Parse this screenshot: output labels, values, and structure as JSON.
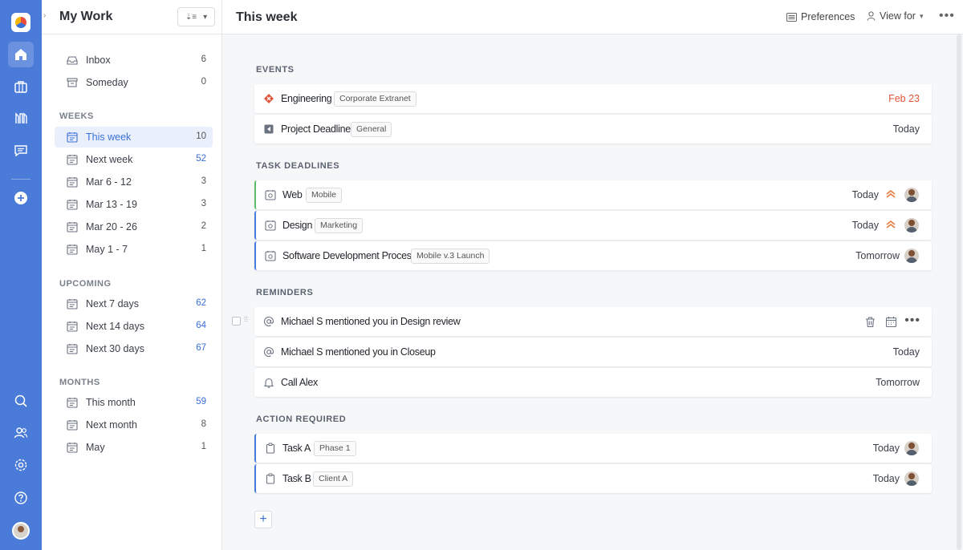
{
  "sidebar": {
    "title": "My Work",
    "top_items": [
      {
        "label": "Inbox",
        "count": "6"
      },
      {
        "label": "Someday",
        "count": "0"
      }
    ],
    "weeks_header": "WEEKS",
    "weeks": [
      {
        "label": "This week",
        "count": "10"
      },
      {
        "label": "Next week",
        "count": "52"
      },
      {
        "label": "Mar 6 - 12",
        "count": "3"
      },
      {
        "label": "Mar 13 - 19",
        "count": "3"
      },
      {
        "label": "Mar 20 - 26",
        "count": "2"
      },
      {
        "label": "May 1 - 7",
        "count": "1"
      }
    ],
    "upcoming_header": "UPCOMING",
    "upcoming": [
      {
        "label": "Next 7 days",
        "count": "62"
      },
      {
        "label": "Next 14 days",
        "count": "64"
      },
      {
        "label": "Next 30 days",
        "count": "67"
      }
    ],
    "months_header": "MONTHS",
    "months": [
      {
        "label": "This month",
        "count": "59"
      },
      {
        "label": "Next month",
        "count": "8"
      },
      {
        "label": "May",
        "count": "1"
      }
    ]
  },
  "topbar": {
    "title": "This week",
    "preferences": "Preferences",
    "view_for": "View for"
  },
  "groups": {
    "events": {
      "header": "EVENTS",
      "rows": [
        {
          "title": "Engineering",
          "tag": "Corporate Extranet",
          "date": "Feb 23"
        },
        {
          "title": "Project Deadline",
          "tag": "General",
          "date": "Today"
        }
      ]
    },
    "task_deadlines": {
      "header": "TASK DEADLINES",
      "rows": [
        {
          "title": "Web",
          "tag": "Mobile",
          "date": "Today"
        },
        {
          "title": "Design",
          "tag": "Marketing",
          "date": "Today"
        },
        {
          "title": "Software Development Process",
          "tag": "Mobile v.3 Launch",
          "date": "Tomorrow"
        }
      ]
    },
    "reminders": {
      "header": "REMINDERS",
      "rows": [
        {
          "title": "Michael S mentioned you in Design review",
          "date": ""
        },
        {
          "title": "Michael S mentioned you in Closeup",
          "date": "Today"
        },
        {
          "title": "Call Alex",
          "date": "Tomorrow"
        }
      ]
    },
    "action_required": {
      "header": "ACTION REQUIRED",
      "rows": [
        {
          "title": "Task A",
          "tag": "Phase 1",
          "date": "Today"
        },
        {
          "title": "Task B",
          "tag": "Client A",
          "date": "Today"
        }
      ]
    }
  },
  "colors": {
    "rail": "#4a7bd8",
    "accent": "#3a6fd8",
    "overdue": "#e0563b",
    "priority": "#e8793a",
    "green_bar": "#5bbb6b"
  },
  "icons": {
    "rail": [
      "app-logo-icon",
      "home-icon",
      "briefcase-icon",
      "projects-icon",
      "chat-icon",
      "add-icon",
      "search-icon",
      "users-icon",
      "settings-icon",
      "help-icon"
    ],
    "topbar": [
      "preferences-icon",
      "user-icon",
      "more-icon"
    ]
  }
}
